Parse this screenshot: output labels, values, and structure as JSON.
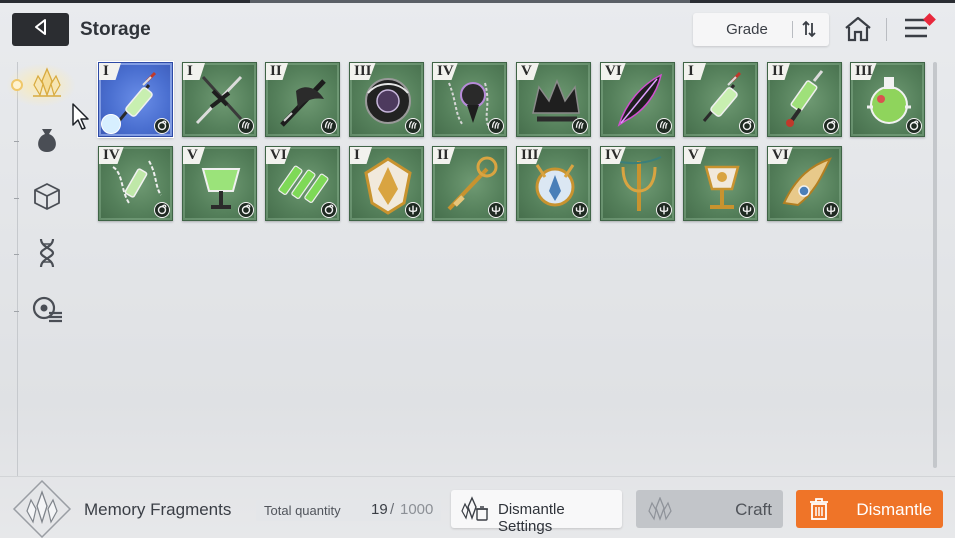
{
  "header": {
    "title": "Storage",
    "sort_label": "Grade"
  },
  "colors": {
    "accent_orange": "#ef7428",
    "tile_green": "#55805b",
    "tile_selected_blue": "#4a6fd0",
    "notification_red": "#e8283c"
  },
  "sidebar": {
    "items": [
      {
        "icon": "memory-fragment-icon",
        "active": true
      },
      {
        "icon": "pouch-icon",
        "active": false
      },
      {
        "icon": "cube-icon",
        "active": false
      },
      {
        "icon": "dna-icon",
        "active": false
      },
      {
        "icon": "record-list-icon",
        "active": false
      }
    ]
  },
  "items": [
    {
      "grade": "I",
      "art": "vial-blade",
      "badge": "swirl",
      "selected": true
    },
    {
      "grade": "I",
      "art": "dark-dagger",
      "badge": "claw"
    },
    {
      "grade": "II",
      "art": "dark-blade",
      "badge": "claw"
    },
    {
      "grade": "III",
      "art": "dark-orb",
      "badge": "claw"
    },
    {
      "grade": "IV",
      "art": "chain-pendant",
      "badge": "claw"
    },
    {
      "grade": "V",
      "art": "dark-crown",
      "badge": "claw"
    },
    {
      "grade": "VI",
      "art": "dark-feather",
      "badge": "claw"
    },
    {
      "grade": "I",
      "art": "vial-blade",
      "badge": "swirl"
    },
    {
      "grade": "II",
      "art": "syringe-key",
      "badge": "swirl"
    },
    {
      "grade": "III",
      "art": "green-flask",
      "badge": "swirl"
    },
    {
      "grade": "IV",
      "art": "chain-vial",
      "badge": "swirl"
    },
    {
      "grade": "V",
      "art": "green-goblet",
      "badge": "swirl"
    },
    {
      "grade": "VI",
      "art": "triple-vial",
      "badge": "swirl"
    },
    {
      "grade": "I",
      "art": "gold-shield",
      "badge": "trident"
    },
    {
      "grade": "II",
      "art": "gold-staff",
      "badge": "trident"
    },
    {
      "grade": "III",
      "art": "gold-emblem",
      "badge": "trident"
    },
    {
      "grade": "IV",
      "art": "gold-trident",
      "badge": "trident"
    },
    {
      "grade": "V",
      "art": "gold-chalice",
      "badge": "trident"
    },
    {
      "grade": "VI",
      "art": "gold-wing",
      "badge": "trident"
    }
  ],
  "footer": {
    "title": "Memory Fragments",
    "quantity_label": "Total quantity",
    "quantity_current": "19",
    "quantity_slash": "/",
    "quantity_max": "1000",
    "settings_button": "Dismantle Settings",
    "craft_button": "Craft",
    "dismantle_button": "Dismantle"
  }
}
